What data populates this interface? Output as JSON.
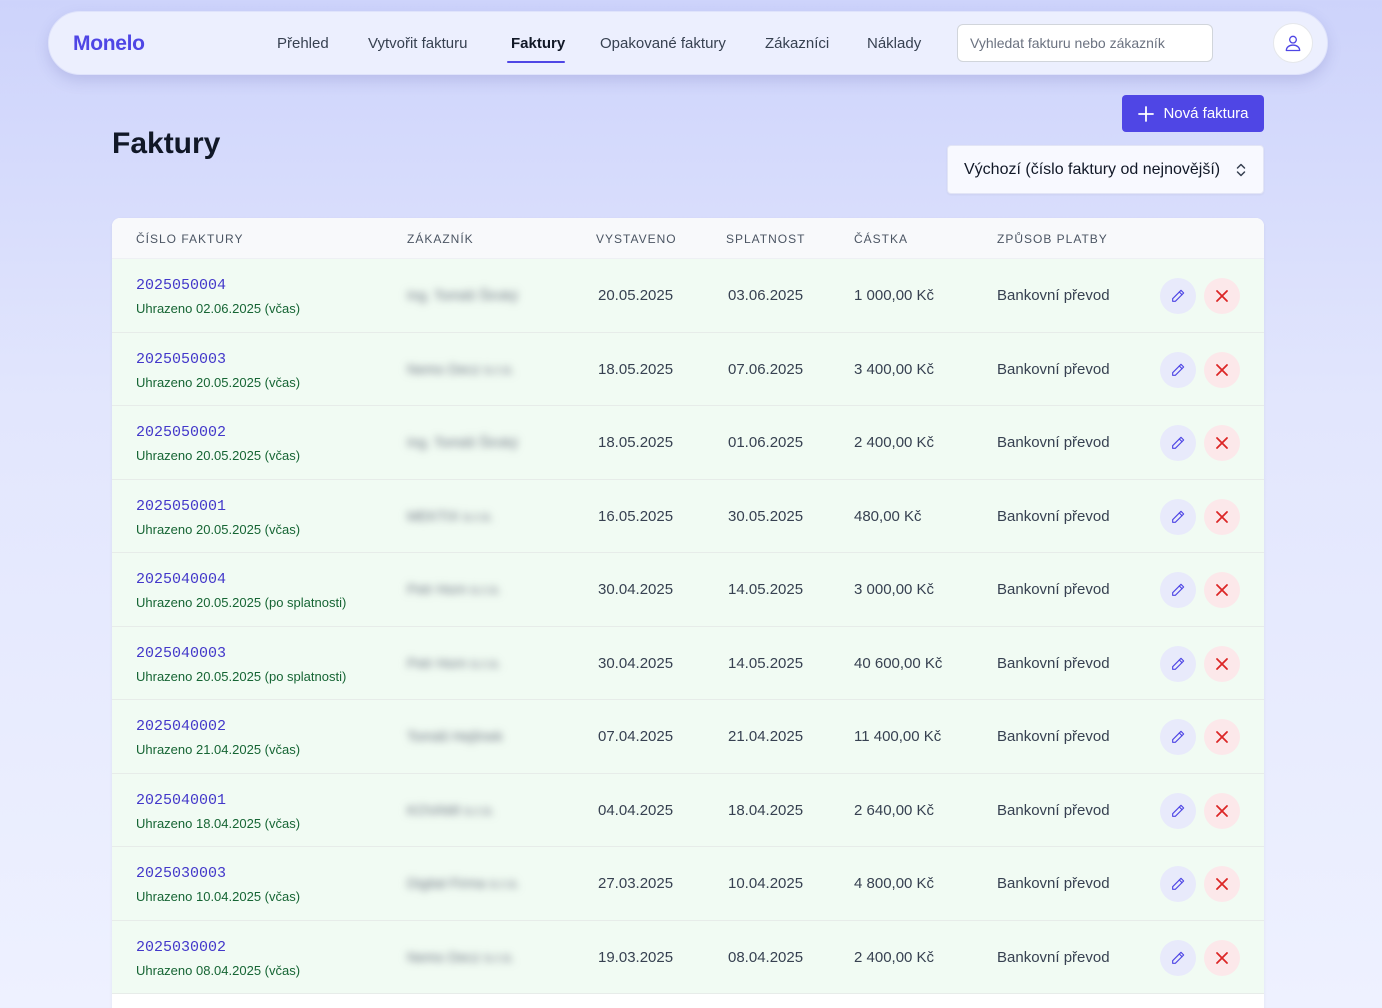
{
  "brand": "Monelo",
  "nav": [
    {
      "label": "Přehled"
    },
    {
      "label": "Vytvořit fakturu"
    },
    {
      "label": "Faktury"
    },
    {
      "label": "Opakované faktury"
    },
    {
      "label": "Zákazníci"
    },
    {
      "label": "Náklady"
    }
  ],
  "nav_active": "Faktury",
  "search": {
    "placeholder": "Vyhledat fakturu nebo zákazník",
    "value": ""
  },
  "user_icon": "user-icon",
  "page": {
    "title": "Faktury",
    "new_button": "Nová faktura",
    "sort_value": "Výchozí (číslo faktury od nejnovější)"
  },
  "colors": {
    "accent": "#4f46e5",
    "paid_text": "#166534",
    "row_bg": "#f1fbf3",
    "delete": "#dc2626"
  },
  "table": {
    "headers": [
      "Číslo faktury",
      "Zákazník",
      "Vystaveno",
      "Splatnost",
      "Částka",
      "Způsob platby"
    ],
    "rows": [
      {
        "number": "2025050004",
        "status": "Uhrazeno 02.06.2025 (včas)",
        "customer": "Ing. Tomáš Široký",
        "issued": "20.05.2025",
        "due": "03.06.2025",
        "amount": "1 000,00 Kč",
        "method": "Bankovní převod"
      },
      {
        "number": "2025050003",
        "status": "Uhrazeno 20.05.2025 (včas)",
        "customer": "Nemo Decz s.r.o.",
        "issued": "18.05.2025",
        "due": "07.06.2025",
        "amount": "3 400,00 Kč",
        "method": "Bankovní převod"
      },
      {
        "number": "2025050002",
        "status": "Uhrazeno 20.05.2025 (včas)",
        "customer": "Ing. Tomáš Široký",
        "issued": "18.05.2025",
        "due": "01.06.2025",
        "amount": "2 400,00 Kč",
        "method": "Bankovní převod"
      },
      {
        "number": "2025050001",
        "status": "Uhrazeno 20.05.2025 (včas)",
        "customer": "MEKTIX s.r.o.",
        "issued": "16.05.2025",
        "due": "30.05.2025",
        "amount": "480,00 Kč",
        "method": "Bankovní převod"
      },
      {
        "number": "2025040004",
        "status": "Uhrazeno 20.05.2025 (po splatnosti)",
        "customer": "Petr Horn s.r.o.",
        "issued": "30.04.2025",
        "due": "14.05.2025",
        "amount": "3 000,00 Kč",
        "method": "Bankovní převod"
      },
      {
        "number": "2025040003",
        "status": "Uhrazeno 20.05.2025 (po splatnosti)",
        "customer": "Petr Horn s.r.o.",
        "issued": "30.04.2025",
        "due": "14.05.2025",
        "amount": "40 600,00 Kč",
        "method": "Bankovní převod"
      },
      {
        "number": "2025040002",
        "status": "Uhrazeno 21.04.2025 (včas)",
        "customer": "Tomáš Hejlínek",
        "issued": "07.04.2025",
        "due": "21.04.2025",
        "amount": "11 400,00 Kč",
        "method": "Bankovní převod"
      },
      {
        "number": "2025040001",
        "status": "Uhrazeno 18.04.2025 (včas)",
        "customer": "KOVAMI s.r.o.",
        "issued": "04.04.2025",
        "due": "18.04.2025",
        "amount": "2 640,00 Kč",
        "method": "Bankovní převod"
      },
      {
        "number": "2025030003",
        "status": "Uhrazeno 10.04.2025 (včas)",
        "customer": "Digital Firma s.r.o.",
        "issued": "27.03.2025",
        "due": "10.04.2025",
        "amount": "4 800,00 Kč",
        "method": "Bankovní převod"
      },
      {
        "number": "2025030002",
        "status": "Uhrazeno 08.04.2025 (včas)",
        "customer": "Nemo Decz s.r.o.",
        "issued": "19.03.2025",
        "due": "08.04.2025",
        "amount": "2 400,00 Kč",
        "method": "Bankovní převod"
      }
    ]
  }
}
